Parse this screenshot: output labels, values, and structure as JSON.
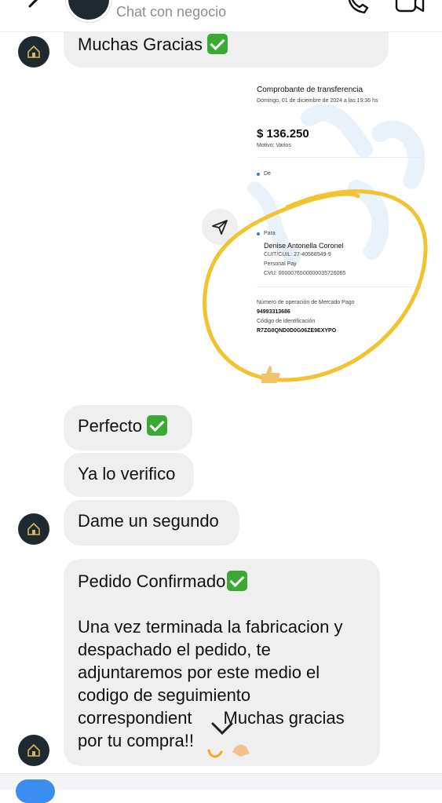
{
  "header": {
    "subtitle": "Chat con negocio"
  },
  "messages": {
    "m1": "Muchas Gracias",
    "m2": "Perfecto",
    "m3": "Ya lo verifico",
    "m4": "Dame un segundo",
    "m5_title": "Pedido Confirmado",
    "m5_l1": "Una vez terminada la fabricacion y",
    "m5_l2": "despachado el pedido, te",
    "m5_l3": "adjuntaremos por este medio el",
    "m5_l4": "codigo de seguimiento",
    "m5_l5a": "correspondient",
    "m5_l5b": "Muchas gracias",
    "m5_l6": "por tu compra!!"
  },
  "receipt": {
    "title": "Comprobante de transferencia",
    "date": "Domingo, 01 de diciembre de 2024 a las 19:36 hs",
    "amount": "$ 136.250",
    "reason": "Motivo: Varios",
    "from_label": "De",
    "to_label": "Para",
    "to_name": "Denise Antonella Coronel",
    "cuit": "CUIT/CUIL: 27-40568549-9",
    "bank": "Personal Pay",
    "cvu": "CVU: 0000076500000035726065",
    "op_label": "Número de operación de Mercado Pago",
    "op_number": "94993313686",
    "id_label": "Código de identificación",
    "id_code": "R7ZG0QND0D0G06ZE9EXYPO"
  },
  "icons": {
    "back": "chevron-left-icon",
    "call": "phone-icon",
    "video": "video-camera-icon",
    "share": "send-icon",
    "scroll": "chevron-down-icon"
  },
  "colors": {
    "bubble": "#efefef",
    "check": "#3aaa35",
    "highlight": "#f2c230",
    "avatar": "#1f2a30",
    "accent": "#3b8df0"
  }
}
